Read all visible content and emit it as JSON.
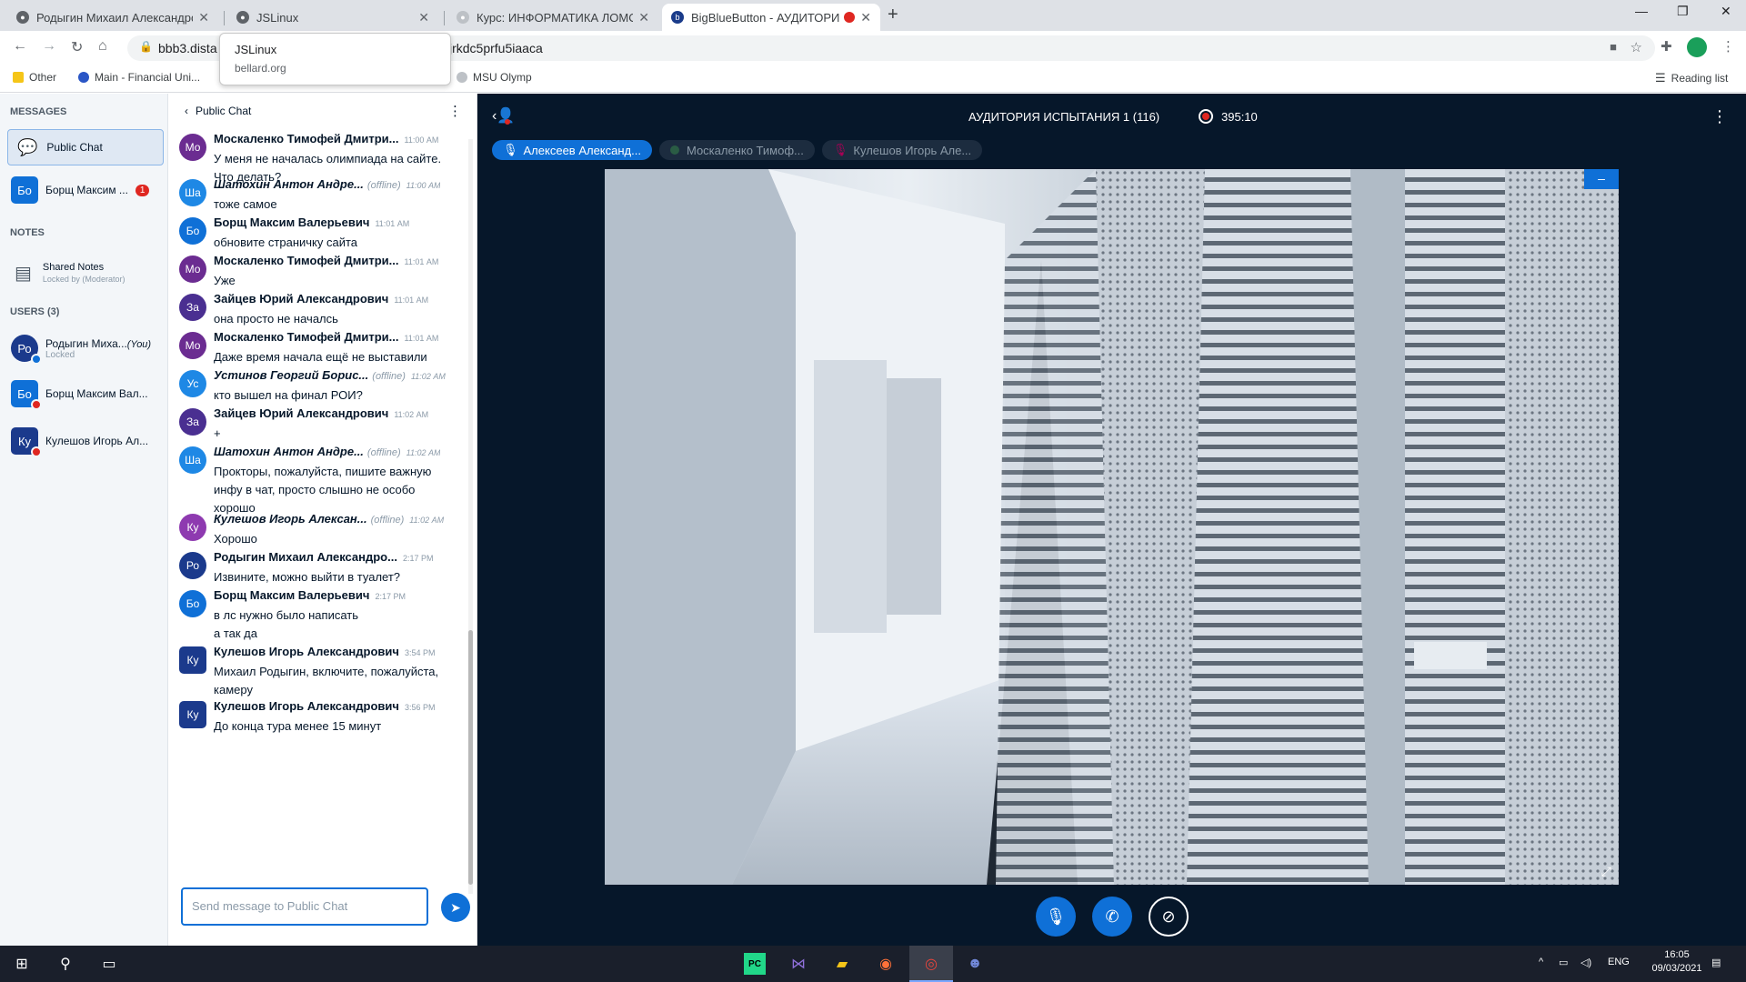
{
  "browser": {
    "tabs": [
      {
        "title": "Родыгин Михаил Александров...",
        "fav_color": "#5f6368"
      },
      {
        "title": "JSLinux",
        "fav_color": "#5f6368"
      },
      {
        "title": "Курс: ИНФОРМАТИКА ЛОМОН...",
        "fav_color": "#bdc1c6"
      },
      {
        "title": "BigBlueButton - АУДИТОРИ...",
        "fav_color": "#1a3b8a"
      }
    ],
    "new_tab": "+",
    "url": "bbb3.dista",
    "url_tail": "jrkdc5prfu5iaaca",
    "tooltip": {
      "title": "JSLinux",
      "domain": "bellard.org"
    },
    "bookmarks": [
      {
        "label": "Other",
        "color": "#f5c518"
      },
      {
        "label": "Main - Financial Uni...",
        "color": "#2a56c6"
      },
      {
        "label": "MSU Olymp",
        "color": "#bdc1c6"
      }
    ],
    "reading_list": "Reading list"
  },
  "sidebar": {
    "messages_heading": "MESSAGES",
    "public_chat": "Public Chat",
    "private_chat": {
      "name": "Борщ Максим ...",
      "avatar": "Бо",
      "unread": "1"
    },
    "notes_heading": "NOTES",
    "shared_notes": "Shared Notes",
    "shared_notes_sub": "Locked by (Moderator)",
    "users_heading": "USERS (3)",
    "users": [
      {
        "name": "Родыгин Миха...",
        "you": "(You)",
        "sub": "Locked",
        "avatar": "Ро",
        "color": "#1b3a8c"
      },
      {
        "name": "Борщ Максим Вал...",
        "you": "",
        "sub": "",
        "avatar": "Бо",
        "color": "#0f70d7"
      },
      {
        "name": "Кулешов Игорь Ал...",
        "you": "",
        "sub": "",
        "avatar": "Ку",
        "color": "#1b3a8c"
      }
    ]
  },
  "chat": {
    "title": "Public Chat",
    "input_placeholder": "Send message to Public Chat",
    "messages": [
      {
        "avatar": "Мо",
        "color": "#6b2c91",
        "name": "Москаленко Тимофей Дмитри...",
        "offline": "",
        "time": "11:00 AM",
        "text": "У меня не началась олимпиада на сайте. Что делать?"
      },
      {
        "avatar": "Ша",
        "color": "#1e88e5",
        "name": "Шатохин Антон Андре...",
        "offline": "(offline)",
        "time": "11:00 AM",
        "text": "тоже самое"
      },
      {
        "avatar": "Бо",
        "color": "#0f70d7",
        "name": "Борщ Максим Валерьевич",
        "offline": "",
        "time": "11:01 AM",
        "text": "обновите страничку сайта"
      },
      {
        "avatar": "Мо",
        "color": "#6b2c91",
        "name": "Москаленко Тимофей Дмитри...",
        "offline": "",
        "time": "11:01 AM",
        "text": "Уже"
      },
      {
        "avatar": "За",
        "color": "#4a2f91",
        "name": "Зайцев Юрий Александрович",
        "offline": "",
        "time": "11:01 AM",
        "text": "она просто не началсь"
      },
      {
        "avatar": "Мо",
        "color": "#6b2c91",
        "name": "Москаленко Тимофей Дмитри...",
        "offline": "",
        "time": "11:01 AM",
        "text": "Даже время начала ещё не выставили"
      },
      {
        "avatar": "Ус",
        "color": "#1e88e5",
        "name": "Устинов Георгий Борис...",
        "offline": "(offline)",
        "time": "11:02 AM",
        "text": "кто вышел на финал РОИ?"
      },
      {
        "avatar": "За",
        "color": "#4a2f91",
        "name": "Зайцев Юрий Александрович",
        "offline": "",
        "time": "11:02 AM",
        "text": "+"
      },
      {
        "avatar": "Ша",
        "color": "#1e88e5",
        "name": "Шатохин Антон Андре...",
        "offline": "(offline)",
        "time": "11:02 AM",
        "text": "Прокторы, пожалуйста, пишите важную инфу в чат, просто слышно не особо хорошо"
      },
      {
        "avatar": "Ку",
        "color": "#8e3ab0",
        "name": "Кулешов Игорь Алексан...",
        "offline": "(offline)",
        "time": "11:02 AM",
        "text": "Хорошо"
      },
      {
        "avatar": "Ро",
        "color": "#1b3a8c",
        "name": "Родыгин Михаил Александро...",
        "offline": "",
        "time": "2:17 PM",
        "text": "Извините, можно выйти в туалет?"
      },
      {
        "avatar": "Бо",
        "color": "#0f70d7",
        "name": "Борщ Максим Валерьевич",
        "offline": "",
        "time": "2:17 PM",
        "text": "в лс нужно было написать",
        "text2": "а так да"
      },
      {
        "avatar": "Ку",
        "color": "#1b3a8c",
        "name": "Кулешов Игорь Александрович",
        "offline": "",
        "time": "3:54 PM",
        "text": "Михаил Родыгин, включите, пожалуйста, камеру"
      },
      {
        "avatar": "Ку",
        "color": "#1b3a8c",
        "name": "Кулешов Игорь Александрович",
        "offline": "",
        "time": "3:56 PM",
        "text": "До конца тура менее 15 минут"
      }
    ]
  },
  "main": {
    "room_title": "АУДИТОРИЯ ИСПЫТАНИЯ 1 (116)",
    "recording_time": "395:10",
    "talkers": [
      {
        "name": "Алексеев Александ...",
        "active": true
      },
      {
        "name": "Москаленко Тимоф...",
        "active": false
      },
      {
        "name": "Кулешов Игорь Але...",
        "active": false
      }
    ],
    "minimize": "–"
  },
  "taskbar": {
    "lang": "ENG",
    "time": "16:05",
    "date": "09/03/2021"
  }
}
